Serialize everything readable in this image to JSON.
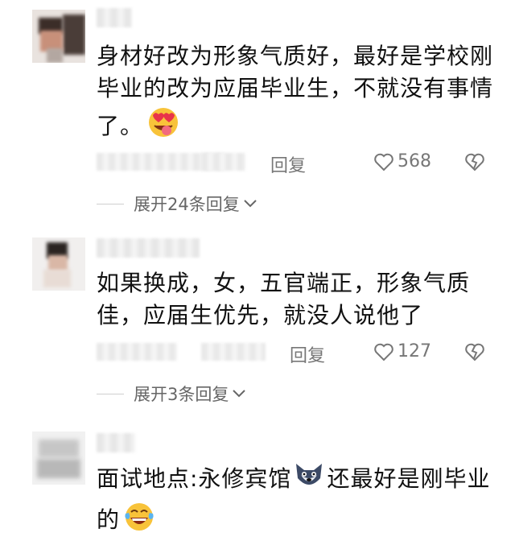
{
  "comments": [
    {
      "text": "身材好改为形象气质好，最好是学校刚毕业的改为应届毕业生，不就没有事情了。",
      "reply_label": "回复",
      "likes": "568",
      "expand_label": "展开24条回复"
    },
    {
      "text": "如果换成，女，五官端正，形象气质佳，应届生优先，就没人说他了",
      "reply_label": "回复",
      "likes": "127",
      "expand_label": "展开3条回复"
    },
    {
      "text": "面试地点:永修宾馆",
      "text_after": "还最好是刚毕业的",
      "reply_label": "",
      "likes": "",
      "expand_label": ""
    }
  ],
  "icons": {
    "like": "heart-outline-icon",
    "dislike": "broken-heart-icon",
    "expand": "chevron-down-icon",
    "emoji_1": "heart-eyes-tongue-emoji",
    "emoji_2": "wolf-face-emoji",
    "emoji_3": "laughing-tears-emoji"
  },
  "colors": {
    "text": "#111111",
    "meta": "#777777",
    "divider": "#cfcfcf"
  }
}
